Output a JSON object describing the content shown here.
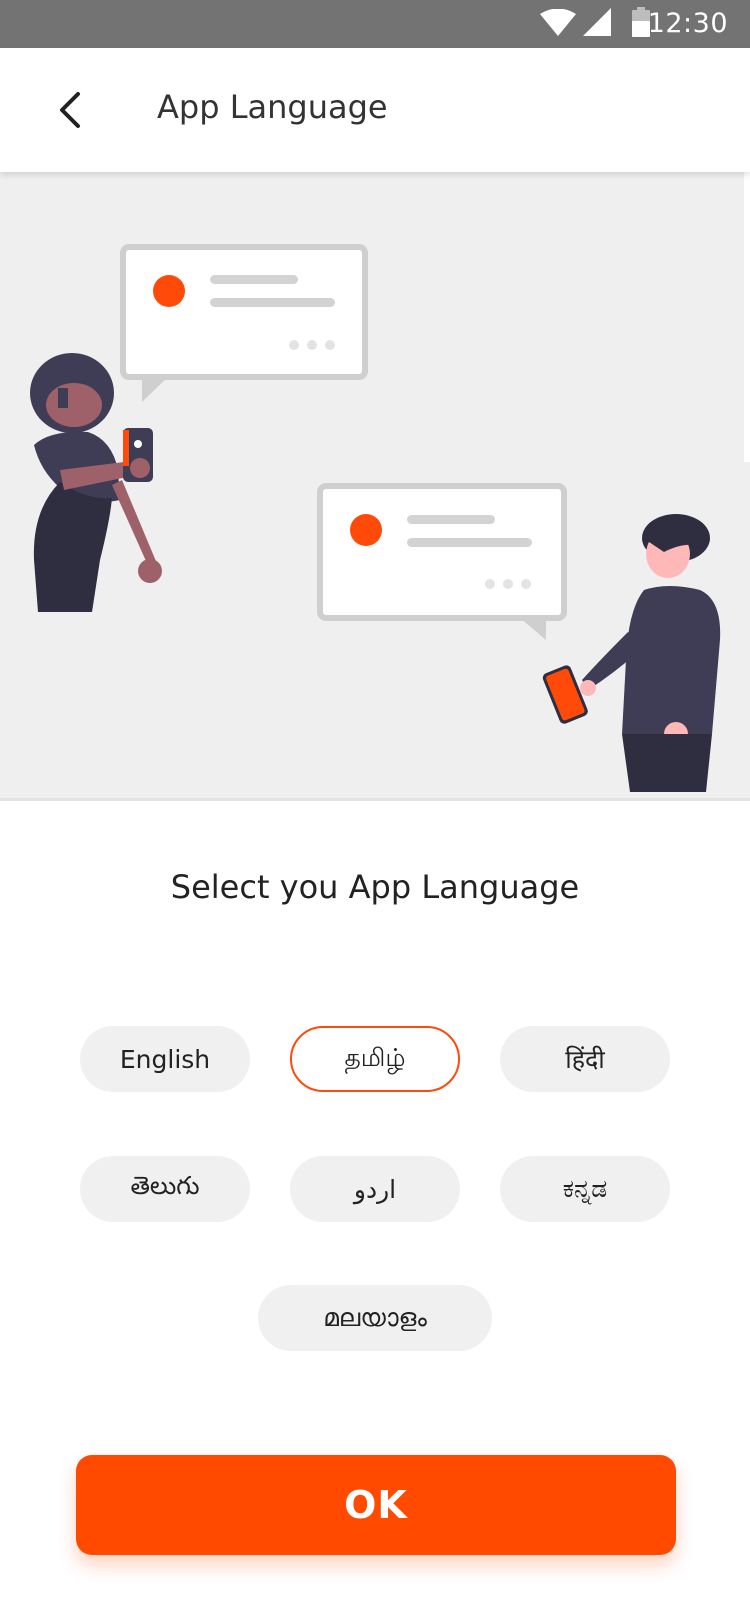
{
  "status_bar": {
    "time": "12:30",
    "icons": [
      "wifi-icon",
      "cellular-signal-icon",
      "battery-icon"
    ]
  },
  "app_bar": {
    "back_icon": "chevron-left-icon",
    "title": "App Language"
  },
  "illustration": {
    "description_icon": "two-people-chatting-illustration",
    "colors": {
      "background": "#f0eff0",
      "accent": "#ff4a00",
      "figure_dark": "#3f3d56",
      "skin": "#9e616a"
    }
  },
  "main": {
    "heading": "Select you App Language",
    "languages": [
      {
        "label": "English",
        "selected": false
      },
      {
        "label": "தமிழ்",
        "selected": true
      },
      {
        "label": "हिंदी",
        "selected": false
      },
      {
        "label": "తెలుగు",
        "selected": false
      },
      {
        "label": "اردو",
        "selected": false
      },
      {
        "label": "ಕನ್ನಡ",
        "selected": false
      },
      {
        "label": "മലയാളം",
        "selected": false
      }
    ]
  },
  "footer": {
    "ok_label": "OK"
  },
  "theme": {
    "accent": "#ff4a00",
    "chip_bg": "#f0f0f0",
    "status_bar_bg": "#737373"
  }
}
